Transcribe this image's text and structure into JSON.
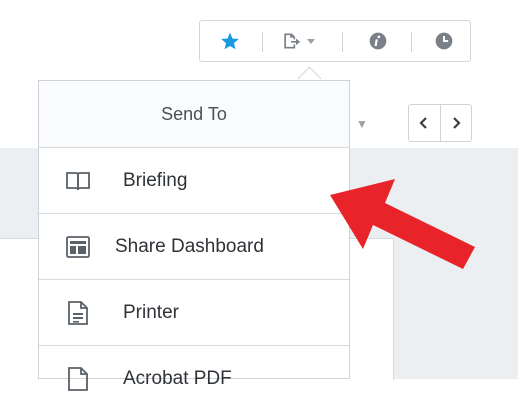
{
  "toolbar": {
    "favorite_icon": "star-icon",
    "share_icon": "export-icon",
    "info_icon": "info-icon",
    "history_icon": "clock-icon",
    "accent_star": "#1a9be0",
    "icon_gray": "#7a8088"
  },
  "nav": {
    "prev_icon": "chevron-left-icon",
    "next_icon": "chevron-right-icon"
  },
  "send_to": {
    "title": "Send To",
    "items": [
      {
        "label": "Briefing",
        "icon": "book-icon"
      },
      {
        "label": "Share Dashboard",
        "icon": "dashboard-icon"
      },
      {
        "label": "Printer",
        "icon": "document-icon"
      },
      {
        "label": "Acrobat PDF",
        "icon": "pdf-icon"
      }
    ]
  },
  "annotation": {
    "arrow_color": "#e8242a"
  }
}
